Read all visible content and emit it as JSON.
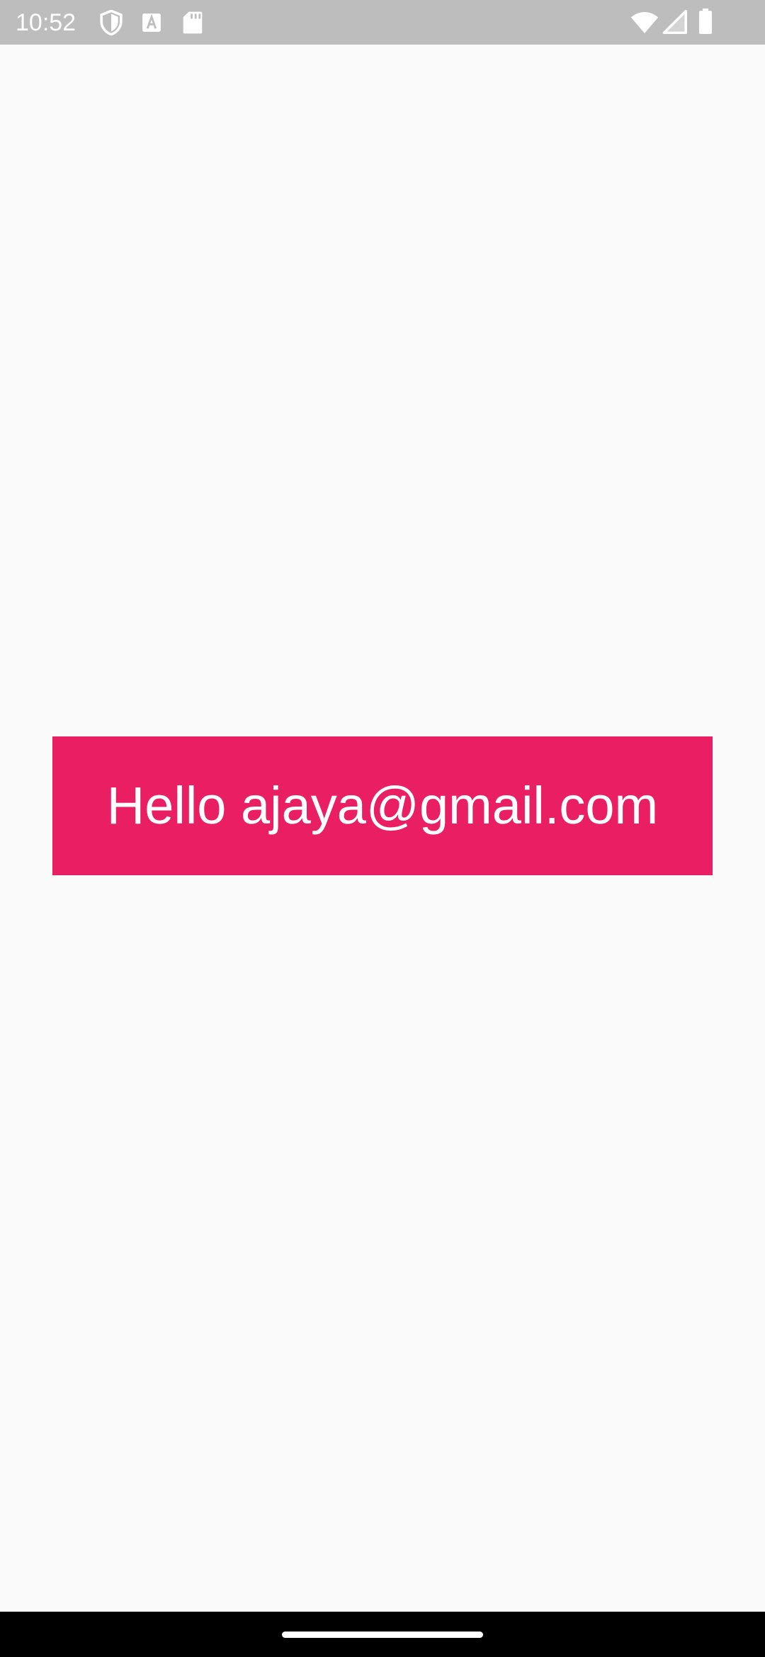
{
  "status_bar": {
    "time": "10:52",
    "icons": [
      "shield-icon",
      "font-a-icon",
      "sd-card-icon",
      "wifi-icon",
      "signal-icon",
      "battery-icon"
    ],
    "background": "#bdbdbd"
  },
  "main": {
    "greeting": "Hello ajaya@gmail.com",
    "greeting_background": "#e91e63",
    "greeting_color": "#ffffff",
    "background": "#fafafa"
  },
  "nav_bar": {
    "background": "#000000",
    "handle": "home-handle"
  }
}
